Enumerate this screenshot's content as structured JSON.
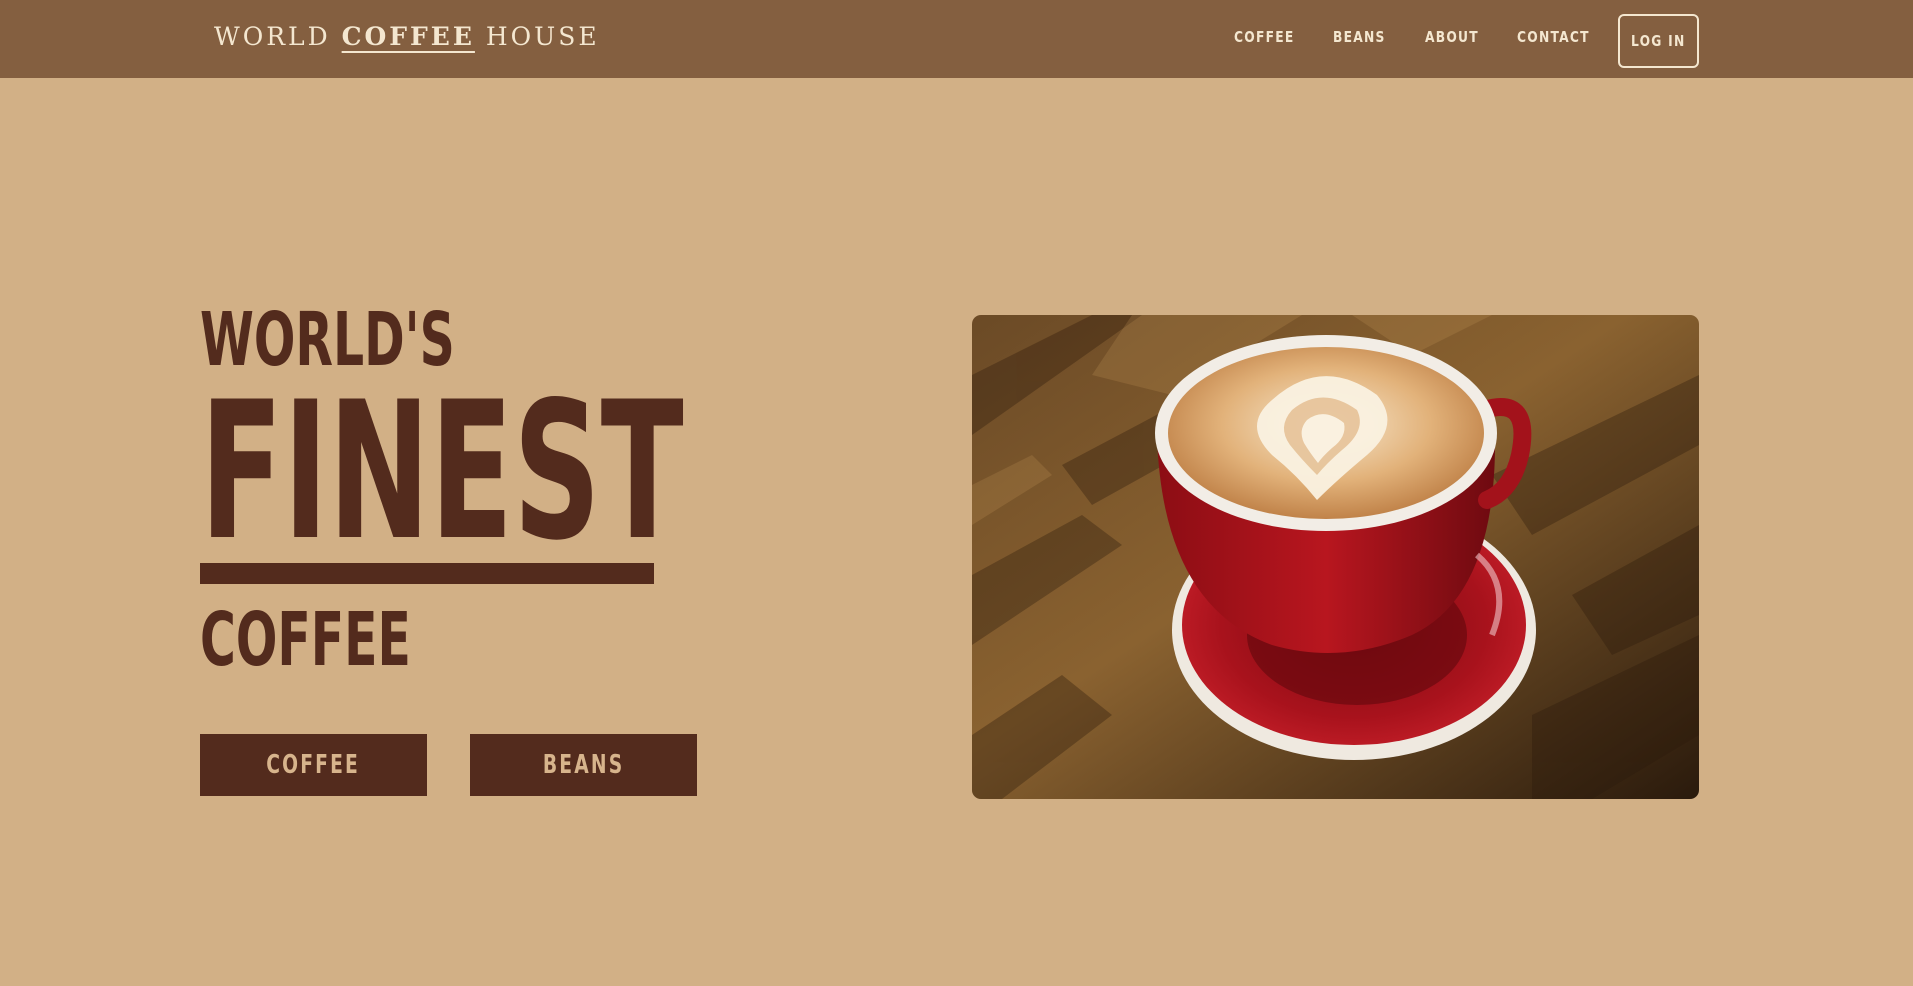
{
  "brand": {
    "part1": "WORLD",
    "part2": "COFFEE",
    "part3": "HOUSE"
  },
  "nav": {
    "coffee": "COFFEE",
    "beans": "BEANS",
    "about": "ABOUT",
    "contact": "CONTACT",
    "login": "LOG IN"
  },
  "hero": {
    "line1": "WORLD'S",
    "line2": "FINEST",
    "line3": "COFFEE",
    "buttons": {
      "coffee": "COFFEE",
      "beans": "BEANS"
    },
    "image_icon": "latte-art-cup-photo"
  },
  "colors": {
    "page_bg": "#d2b086",
    "header_bg": "#845f40",
    "header_text": "#f4e7d0",
    "accent_dark": "#532b1d",
    "button_text": "#d7b48c"
  }
}
